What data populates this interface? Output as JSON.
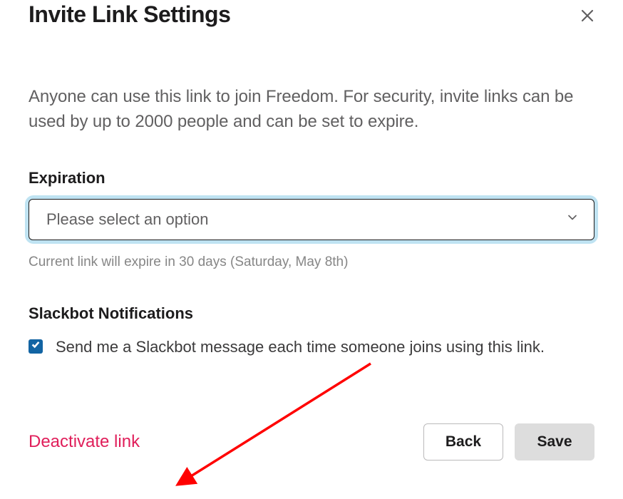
{
  "modal": {
    "title": "Invite Link Settings",
    "description": "Anyone can use this link to join Freedom. For security, invite links can be used by up to 2000 people and can be set to expire."
  },
  "expiration": {
    "label": "Expiration",
    "placeholder": "Please select an option",
    "helper_text": "Current link will expire in 30 days (Saturday, May 8th)"
  },
  "notifications": {
    "label": "Slackbot Notifications",
    "checkbox_label": "Send me a Slackbot message each time someone joins using this link.",
    "checked": true
  },
  "actions": {
    "deactivate": "Deactivate link",
    "back": "Back",
    "save": "Save"
  },
  "colors": {
    "danger": "#e01e5a",
    "primary": "#1264a3",
    "focus_ring": "#bfe3f2"
  }
}
